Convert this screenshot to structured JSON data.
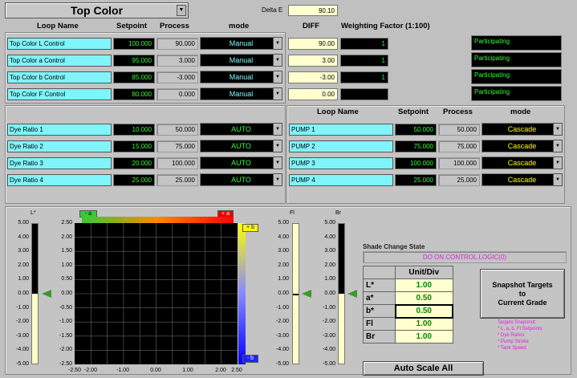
{
  "title": "Top Color",
  "delta_e": {
    "label": "Delta E",
    "value": "90.10"
  },
  "left_headers": {
    "loop_name": "Loop Name",
    "setpoint": "Setpoint",
    "process": "Process",
    "mode": "mode"
  },
  "diff_header": "DIFF",
  "weighting_header": "Weighting Factor (1:100)",
  "top_loops": [
    {
      "name": "Top Color L Control",
      "setpoint": "100.000",
      "process": "90.000",
      "mode": "Manual",
      "diff": "90.00",
      "weight": "1",
      "status": "Participating"
    },
    {
      "name": "Top Color a Control",
      "setpoint": "95.000",
      "process": "3.000",
      "mode": "Manual",
      "diff": "3.00",
      "weight": "1",
      "status": "Participating"
    },
    {
      "name": "Top Color b Control",
      "setpoint": "85.000",
      "process": "-3.000",
      "mode": "Manual",
      "diff": "-3.00",
      "weight": "1",
      "status": "Participating"
    },
    {
      "name": "Top Color F Control",
      "setpoint": "80.000",
      "process": "0.000",
      "mode": "Manual",
      "diff": "0.00",
      "weight": "",
      "status": "Participating"
    }
  ],
  "dye_loops": [
    {
      "name": "Dye Ratio 1",
      "setpoint": "10.000",
      "process": "50.000",
      "mode": "AUTO"
    },
    {
      "name": "Dye Ratio 2",
      "setpoint": "15.000",
      "process": "75.000",
      "mode": "AUTO"
    },
    {
      "name": "Dye Ratio 3",
      "setpoint": "20.000",
      "process": "100.000",
      "mode": "AUTO"
    },
    {
      "name": "Dye Ratio 4",
      "setpoint": "25.000",
      "process": "25.000",
      "mode": "AUTO"
    }
  ],
  "right_headers": {
    "loop_name": "Loop Name",
    "setpoint": "Setpoint",
    "process": "Process",
    "mode": "mode"
  },
  "pump_loops": [
    {
      "name": "PUMP 1",
      "setpoint": "50.000",
      "process": "50.000",
      "mode": "Cascade"
    },
    {
      "name": "PUMP 2",
      "setpoint": "75.000",
      "process": "75.000",
      "mode": "Cascade"
    },
    {
      "name": "PUMP 3",
      "setpoint": "100.000",
      "process": "100.000",
      "mode": "Cascade"
    },
    {
      "name": "PUMP 4",
      "setpoint": "25.000",
      "process": "25.000",
      "mode": "Cascade"
    }
  ],
  "l_axis": {
    "label": "L*",
    "ticks": [
      "5.00",
      "4.00",
      "3.00",
      "2.00",
      "1.00",
      "0.00",
      "-1.00",
      "-2.00",
      "-3.00",
      "-4.00",
      "-5.00"
    ],
    "fill_fraction": 0.5
  },
  "ab_chart": {
    "minus_a": "- a",
    "plus_a": "+ a",
    "plus_b": "+ b",
    "minus_b": "- b",
    "y_ticks": [
      "2.50",
      "2.00",
      "1.50",
      "1.00",
      "0.50",
      "0.00",
      "-0.50",
      "-1.00",
      "-1.50",
      "-2.00",
      "-2.50"
    ],
    "x_ticks": [
      "-2.50",
      "-2.00",
      "-1.00",
      "0.00",
      "1.00",
      "2.00",
      "2.50"
    ]
  },
  "fl_axis": {
    "label": "Fl",
    "ticks": [
      "5.00",
      "4.00",
      "3.00",
      "2.00",
      "1.00",
      "0.00",
      "-1.00",
      "-2.00",
      "-3.00",
      "-4.00",
      "-5.00"
    ]
  },
  "br_axis": {
    "label": "Br",
    "ticks": [
      "5.00",
      "4.00",
      "3.00",
      "2.00",
      "1.00",
      "0.00",
      "-1.00",
      "-2.00",
      "-3.00",
      "-4.00",
      "-5.00"
    ]
  },
  "shade_change": {
    "label": "Shade Change State",
    "value": "DO ON CONTROL LOGIC(0)"
  },
  "unit_div": {
    "header": "Unit/Div",
    "rows": [
      {
        "name": "L*",
        "value": "1.00"
      },
      {
        "name": "a*",
        "value": "0.50"
      },
      {
        "name": "b*",
        "value": "0.50"
      },
      {
        "name": "Fl",
        "value": "1.00"
      },
      {
        "name": "Br",
        "value": "1.00"
      }
    ]
  },
  "snapshot_button": {
    "line1": "Snapshot Targets",
    "line2": "to",
    "line3": "Current Grade"
  },
  "snapshot_note": [
    "Targets Snapshot:",
    "* L, a, b, Fl Setpoints",
    "* Dye Ratios",
    "* Pump Stroke",
    "* Tank Speed"
  ],
  "auto_scale_button": "Auto Scale All",
  "colors": {
    "cyan": "#7ff4fa",
    "green_text": "#33ff33",
    "magenta": "#e020e0",
    "marker": "#3a9a2a"
  }
}
